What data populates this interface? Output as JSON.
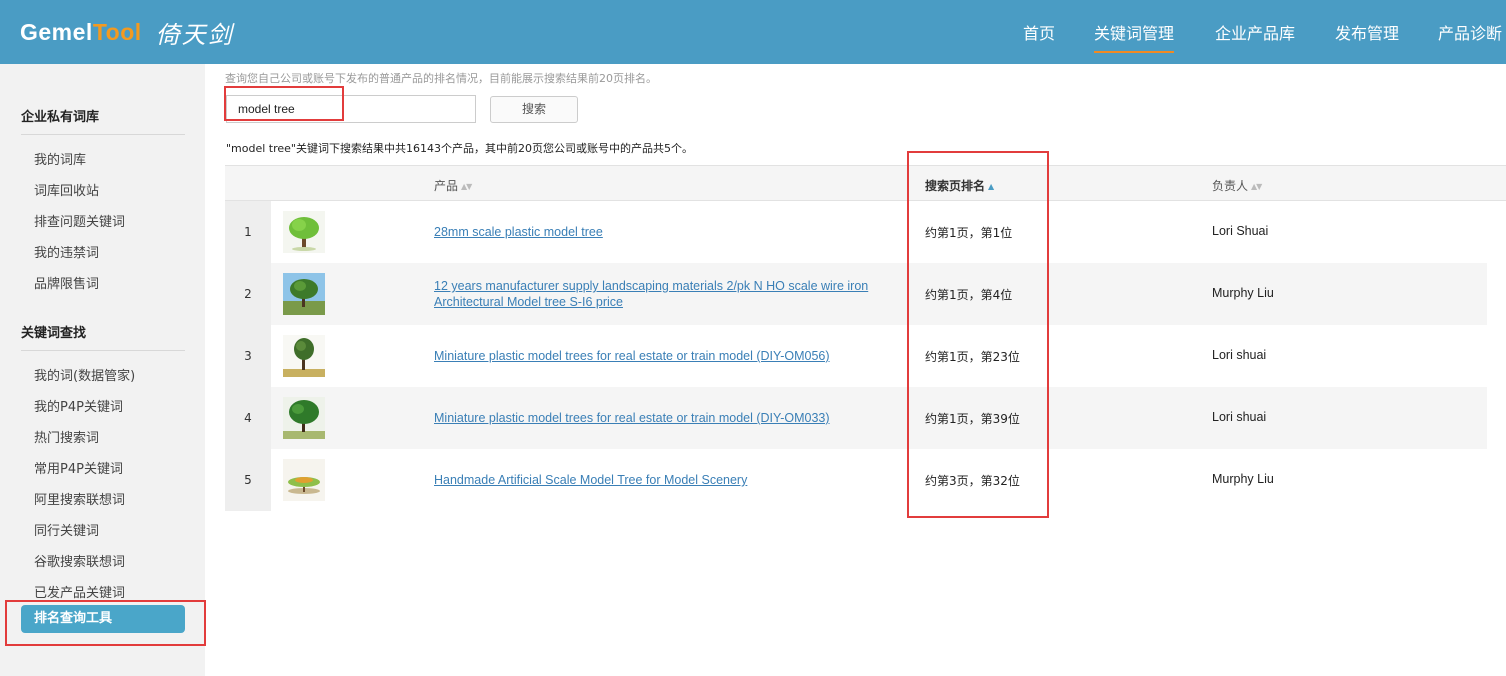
{
  "header": {
    "logo_part1": "Gemel",
    "logo_part2": "Tool",
    "logo_chinese": "倚天剑",
    "nav": [
      "首页",
      "关键词管理",
      "企业产品库",
      "发布管理",
      "产品诊断"
    ],
    "active_nav": "关键词管理"
  },
  "sidebar": {
    "section1_title": "企业私有词库",
    "section1_items": [
      "我的词库",
      "词库回收站",
      "排查问题关键词",
      "我的违禁词",
      "品牌限售词"
    ],
    "section2_title": "关键词查找",
    "section2_items": [
      "我的词(数据管家)",
      "我的P4P关键词",
      "热门搜索词",
      "常用P4P关键词",
      "阿里搜索联想词",
      "同行关键词",
      "谷歌搜索联想词",
      "已发产品关键词"
    ],
    "active_item": "排名查询工具"
  },
  "main": {
    "hint": "查询您自己公司或账号下发布的普通产品的排名情况，目前能展示搜索结果前20页排名。",
    "search_value": "model tree",
    "search_button": "搜索",
    "summary": "\"model tree\"关键词下搜索结果中共16143个产品，其中前20页您公司或账号中的产品共5个。"
  },
  "table": {
    "columns": [
      "产品",
      "搜索页排名",
      "负责人"
    ],
    "rows": [
      {
        "index": "1",
        "product": "28mm scale plastic model tree",
        "rank": "约第1页，第1位",
        "owner": "Lori Shuai",
        "thumb": "tree-thumbnail-1"
      },
      {
        "index": "2",
        "product": "12 years manufacturer supply landscaping materials 2/pk N HO scale wire iron Architectural Model tree S-I6 price",
        "rank": "约第1页，第4位",
        "owner": "Murphy Liu",
        "thumb": "tree-thumbnail-2"
      },
      {
        "index": "3",
        "product": "Miniature plastic model trees for real estate or train model (DIY-OM056)",
        "rank": "约第1页，第23位",
        "owner": "Lori shuai",
        "thumb": "tree-thumbnail-3"
      },
      {
        "index": "4",
        "product": "Miniature plastic model trees for real estate or train model (DIY-OM033)",
        "rank": "约第1页，第39位",
        "owner": "Lori shuai",
        "thumb": "tree-thumbnail-4"
      },
      {
        "index": "5",
        "product": "Handmade Artificial Scale Model Tree for Model Scenery",
        "rank": "约第3页，第32位",
        "owner": "Murphy Liu",
        "thumb": "tree-thumbnail-5"
      }
    ]
  },
  "colors": {
    "header": "#4a9cc4",
    "accent_orange": "#f39a20",
    "link": "#3a7fb6",
    "highlight_red": "#e23c3c",
    "sidebar_active": "#4aa6c9"
  }
}
